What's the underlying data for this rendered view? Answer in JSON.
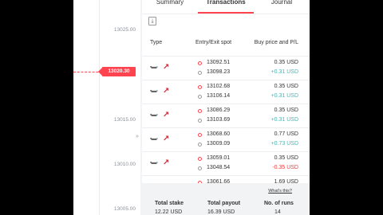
{
  "chart": {
    "ticks": [
      "13025.00",
      "13015.00",
      "13010.00",
      "13005.00"
    ],
    "current_price": "13020.30",
    "collapse_icon": "chevron-right-icon"
  },
  "tabs": [
    {
      "label": "Summary"
    },
    {
      "label": "Transactions",
      "active": true
    },
    {
      "label": "Journal"
    }
  ],
  "table": {
    "headers": {
      "type": "Type",
      "entry_exit": "Entry/Exit spot",
      "buy_pl": "Buy price and P/L"
    },
    "rows": [
      {
        "entry": "13092.51",
        "exit": "13098.23",
        "buy": "0.35 USD",
        "pl": "+0.31 USD",
        "pl_status": "positive"
      },
      {
        "entry": "13102.68",
        "exit": "13106.14",
        "buy": "0.35 USD",
        "pl": "+0.31 USD",
        "pl_status": "positive"
      },
      {
        "entry": "13086.29",
        "exit": "13103.69",
        "buy": "0.35 USD",
        "pl": "+0.31 USD",
        "pl_status": "positive"
      },
      {
        "entry": "13068.60",
        "exit": "13009.09",
        "buy": "0.77 USD",
        "pl": "+0.73 USD",
        "pl_status": "positive"
      },
      {
        "entry": "13059.01",
        "exit": "13048.54",
        "buy": "0.35 USD",
        "pl": "-0.35 USD",
        "pl_status": "negative"
      },
      {
        "entry": "13061.66",
        "exit": "",
        "buy": "1.69 USD",
        "pl": "",
        "pl_status": "positive"
      }
    ]
  },
  "footer": {
    "whats_this": "What's this?",
    "total_stake_label": "Total stake",
    "total_stake_value": "12.22 USD",
    "total_payout_label": "Total payout",
    "total_payout_value": "16.39 USD",
    "runs_label": "No. of runs",
    "runs_value": "14"
  },
  "colors": {
    "accent": "#ff444f",
    "profit": "#4bb4b3",
    "loss": "#ec3f3f"
  }
}
